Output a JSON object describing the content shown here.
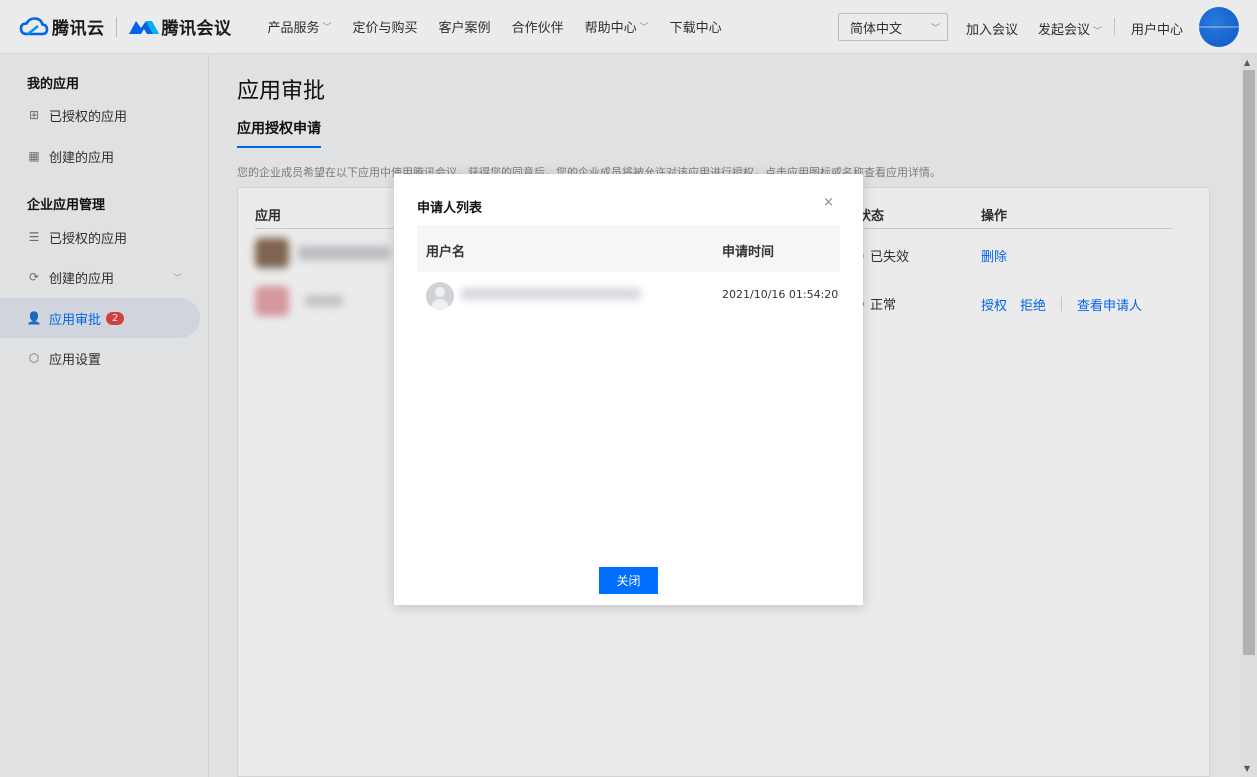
{
  "header": {
    "brand_tencent_cloud": "腾讯云",
    "brand_tencent_meeting": "腾讯会议",
    "nav": [
      {
        "label": "产品服务",
        "has_dropdown": true
      },
      {
        "label": "定价与购买",
        "has_dropdown": false
      },
      {
        "label": "客户案例",
        "has_dropdown": false
      },
      {
        "label": "合作伙伴",
        "has_dropdown": false
      },
      {
        "label": "帮助中心",
        "has_dropdown": true
      },
      {
        "label": "下载中心",
        "has_dropdown": false
      }
    ],
    "language": "简体中文",
    "join_meeting": "加入会议",
    "start_meeting": "发起会议",
    "user_center": "用户中心",
    "accent_color": "#006eff"
  },
  "sidebar": {
    "group1_title": "我的应用",
    "group1_items": [
      {
        "label": "已授权的应用",
        "icon": "authorized-app-icon"
      },
      {
        "label": "创建的应用",
        "icon": "grid-app-icon"
      }
    ],
    "group2_title": "企业应用管理",
    "group2_items": [
      {
        "label": "已授权的应用",
        "icon": "list-icon"
      },
      {
        "label": "创建的应用",
        "icon": "create-app-icon",
        "expandable": true
      },
      {
        "label": "应用审批",
        "icon": "user-icon",
        "badge": "2",
        "active": true
      },
      {
        "label": "应用设置",
        "icon": "settings-icon"
      }
    ]
  },
  "main": {
    "title": "应用审批",
    "tab": "应用授权申请",
    "hint": "您的企业成员希望在以下应用中使用腾讯会议，获得您的同意后，您的企业成员将被允许对该应用进行授权，点击应用图标或名称查看应用详情。",
    "columns": {
      "app": "应用",
      "status": "状态",
      "actions": "操作"
    },
    "rows": [
      {
        "status": "已失效",
        "status_color": "#b0b4ba",
        "actions": [
          "删除"
        ]
      },
      {
        "status": "正常",
        "status_color": "#2bb46e",
        "actions": [
          "授权",
          "拒绝",
          "查看申请人"
        ]
      }
    ]
  },
  "modal": {
    "title": "申请人列表",
    "close_icon": "×",
    "columns": {
      "username": "用户名",
      "time": "申请时间"
    },
    "rows": [
      {
        "time": "2021/10/16 01:54:20"
      }
    ],
    "close_button": "关闭"
  }
}
